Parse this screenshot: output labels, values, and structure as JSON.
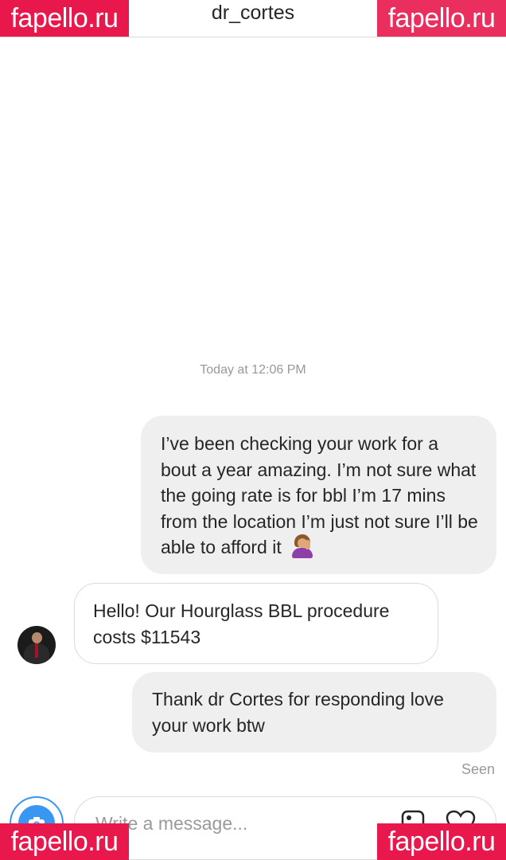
{
  "header": {
    "title": "dr_cortes"
  },
  "conversation": {
    "timestamp": "Today at 12:06 PM",
    "messages": [
      {
        "direction": "outgoing",
        "text": "I’ve been checking your work for a bout a year amazing. I’m not sure what the going rate is for bbl I’m 17 mins from the location I’m just not sure I’ll be able to afford it",
        "emoji": "person-facepalming"
      },
      {
        "direction": "incoming",
        "text": "Hello! Our Hourglass BBL procedure costs $11543"
      },
      {
        "direction": "outgoing",
        "text": "Thank dr Cortes for responding love your work btw"
      }
    ],
    "seen_label": "Seen"
  },
  "composer": {
    "placeholder": "Write a message...",
    "accent_color": "#3897f0"
  },
  "watermark": {
    "text": "fapello.ru",
    "color": "#e8184d"
  }
}
